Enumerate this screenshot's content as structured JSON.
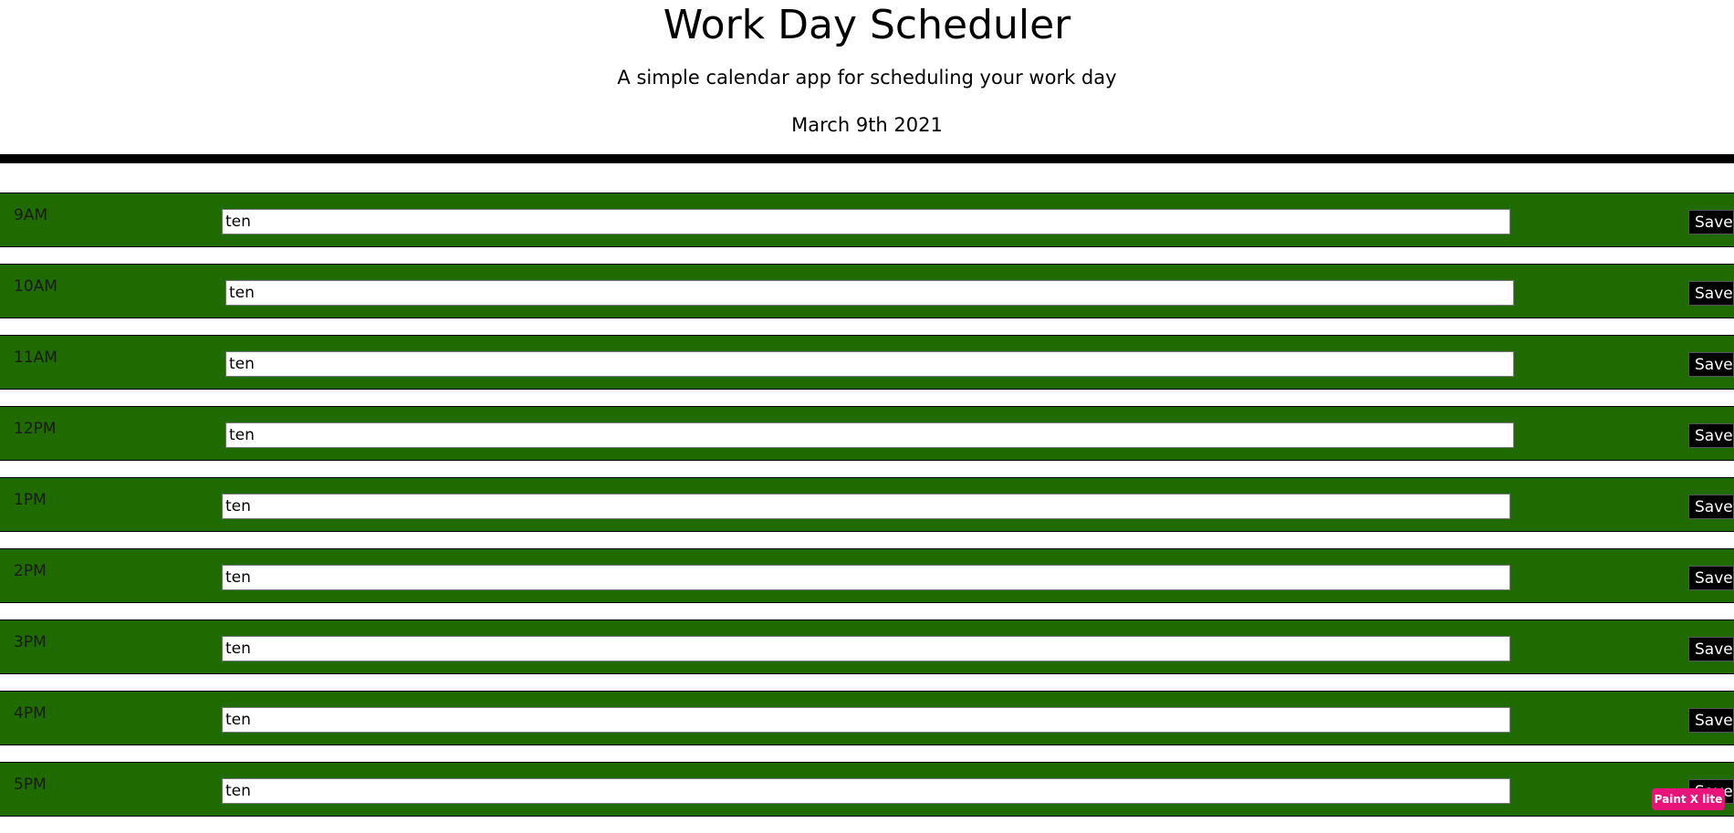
{
  "header": {
    "title": "Work Day Scheduler",
    "subtitle": "A simple calendar app for scheduling your work day",
    "date": "March 9th 2021"
  },
  "colors": {
    "row_background": "#1f6b00",
    "divider": "#000000",
    "save_button": "#000000"
  },
  "rows": [
    {
      "hour": "9AM",
      "task": "ten",
      "save_label": "Save"
    },
    {
      "hour": "10AM",
      "task": "ten",
      "save_label": "Save"
    },
    {
      "hour": "11AM",
      "task": "ten",
      "save_label": "Save"
    },
    {
      "hour": "12PM",
      "task": "ten",
      "save_label": "Save"
    },
    {
      "hour": "1PM",
      "task": "ten",
      "save_label": "Save"
    },
    {
      "hour": "2PM",
      "task": "ten",
      "save_label": "Save"
    },
    {
      "hour": "3PM",
      "task": "ten",
      "save_label": "Save"
    },
    {
      "hour": "4PM",
      "task": "ten",
      "save_label": "Save"
    },
    {
      "hour": "5PM",
      "task": "ten",
      "save_label": "Save"
    }
  ],
  "badge": {
    "label": "Paint X lite"
  }
}
